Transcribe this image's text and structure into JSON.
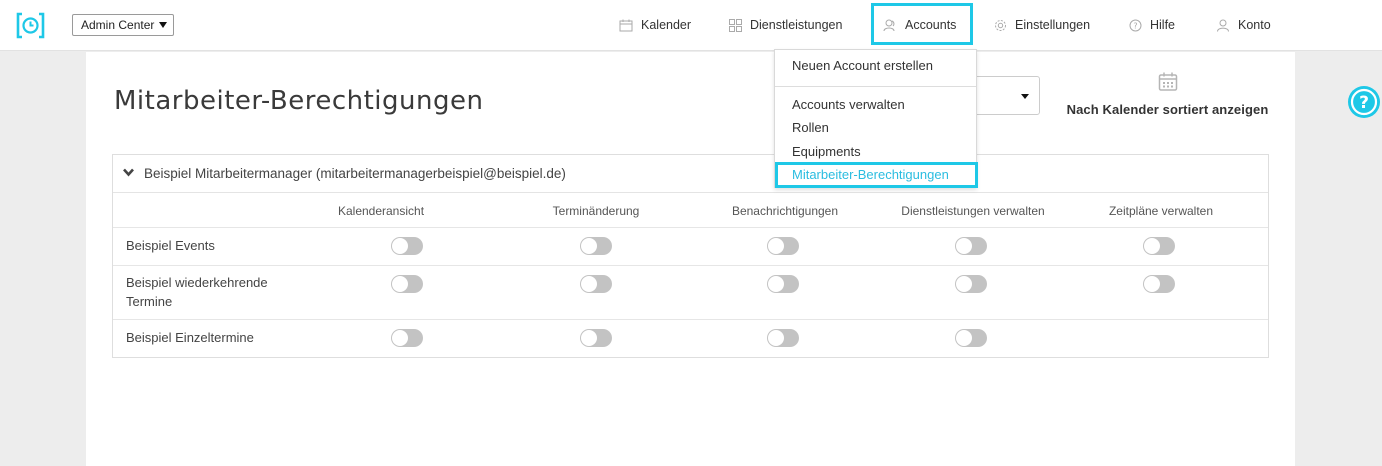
{
  "topbar": {
    "logo_icon": "clock-bracket-icon",
    "admin_select_value": "Admin Center",
    "nav": [
      {
        "label": "Kalender",
        "icon": "calendar-icon"
      },
      {
        "label": "Dienstleistungen",
        "icon": "grid-icon"
      },
      {
        "label": "Accounts",
        "icon": "users-icon"
      },
      {
        "label": "Einstellungen",
        "icon": "gear-icon"
      },
      {
        "label": "Hilfe",
        "icon": "question-circle-icon"
      },
      {
        "label": "Konto",
        "icon": "user-icon"
      }
    ]
  },
  "page": {
    "title": "Mitarbeiter-Berechtigungen",
    "calendar_sort_label": "Nach Kalender sortiert anzeigen"
  },
  "dropdown": {
    "items": [
      "Neuen Account erstellen",
      "Accounts verwalten",
      "Rollen",
      "Equipments",
      "Mitarbeiter-Berechtigungen"
    ],
    "active_index": 4
  },
  "card": {
    "header": "Beispiel Mitarbeitermanager (mitarbeitermanagerbeispiel@beispiel.de)",
    "columns": [
      "Kalenderansicht",
      "Terminänderung",
      "Benachrichtigungen",
      "Dienstleistungen verwalten",
      "Zeitpläne verwalten"
    ],
    "rows": [
      {
        "label": "Beispiel Events",
        "toggles": [
          false,
          false,
          false,
          false,
          false
        ]
      },
      {
        "label": "Beispiel wiederkehrende Termine",
        "toggles": [
          false,
          false,
          false,
          false,
          false
        ]
      },
      {
        "label": "Beispiel Einzeltermine",
        "toggles": [
          false,
          false,
          false,
          false
        ]
      }
    ]
  },
  "colors": {
    "accent": "#1ec8e7",
    "toggle_off": "#c3c3c3",
    "background": "#ededed"
  }
}
